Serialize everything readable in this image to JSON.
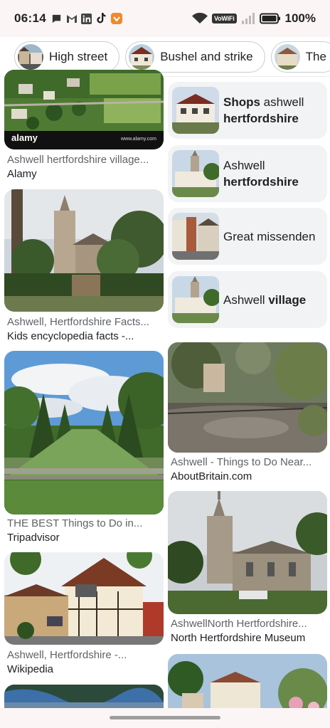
{
  "status_bar": {
    "time": "06:14",
    "battery": "100%",
    "vowifi": "VoWiFi"
  },
  "chips": [
    {
      "label": "High street"
    },
    {
      "label": "Bushel and strike"
    },
    {
      "label": "The"
    }
  ],
  "left_column": [
    {
      "title": "Ashwell hertfordshire village...",
      "source": "Alamy",
      "watermark": "alamy",
      "watermark_url": "www.alamy.com"
    },
    {
      "title": "Ashwell, Hertfordshire Facts...",
      "source": "Kids encyclopedia facts -..."
    },
    {
      "title": "THE BEST Things to Do in...",
      "source": "Tripadvisor"
    },
    {
      "title": "Ashwell, Hertfordshire -...",
      "source": "Wikipedia"
    }
  ],
  "related_searches": [
    {
      "bold_first": "Shops",
      "normal": " ashwell ",
      "bold_last": "hertfordshire"
    },
    {
      "normal_first": "Ashwell ",
      "bold": "hertfordshire"
    },
    {
      "text": "Great missenden"
    },
    {
      "normal_first": "Ashwell ",
      "bold": "village"
    }
  ],
  "right_column": [
    {
      "title": "Ashwell - Things to Do Near...",
      "source": "AboutBritain.com"
    },
    {
      "title": "AshwellNorth Hertfordshire...",
      "source": "North Hertfordshire Museum"
    }
  ],
  "colors": {
    "status_bg": "#fcf5f5",
    "chip_border": "#c9cdd3",
    "related_bg": "#f1f3f4",
    "title_text": "#5f6368",
    "source_text": "#202124"
  }
}
